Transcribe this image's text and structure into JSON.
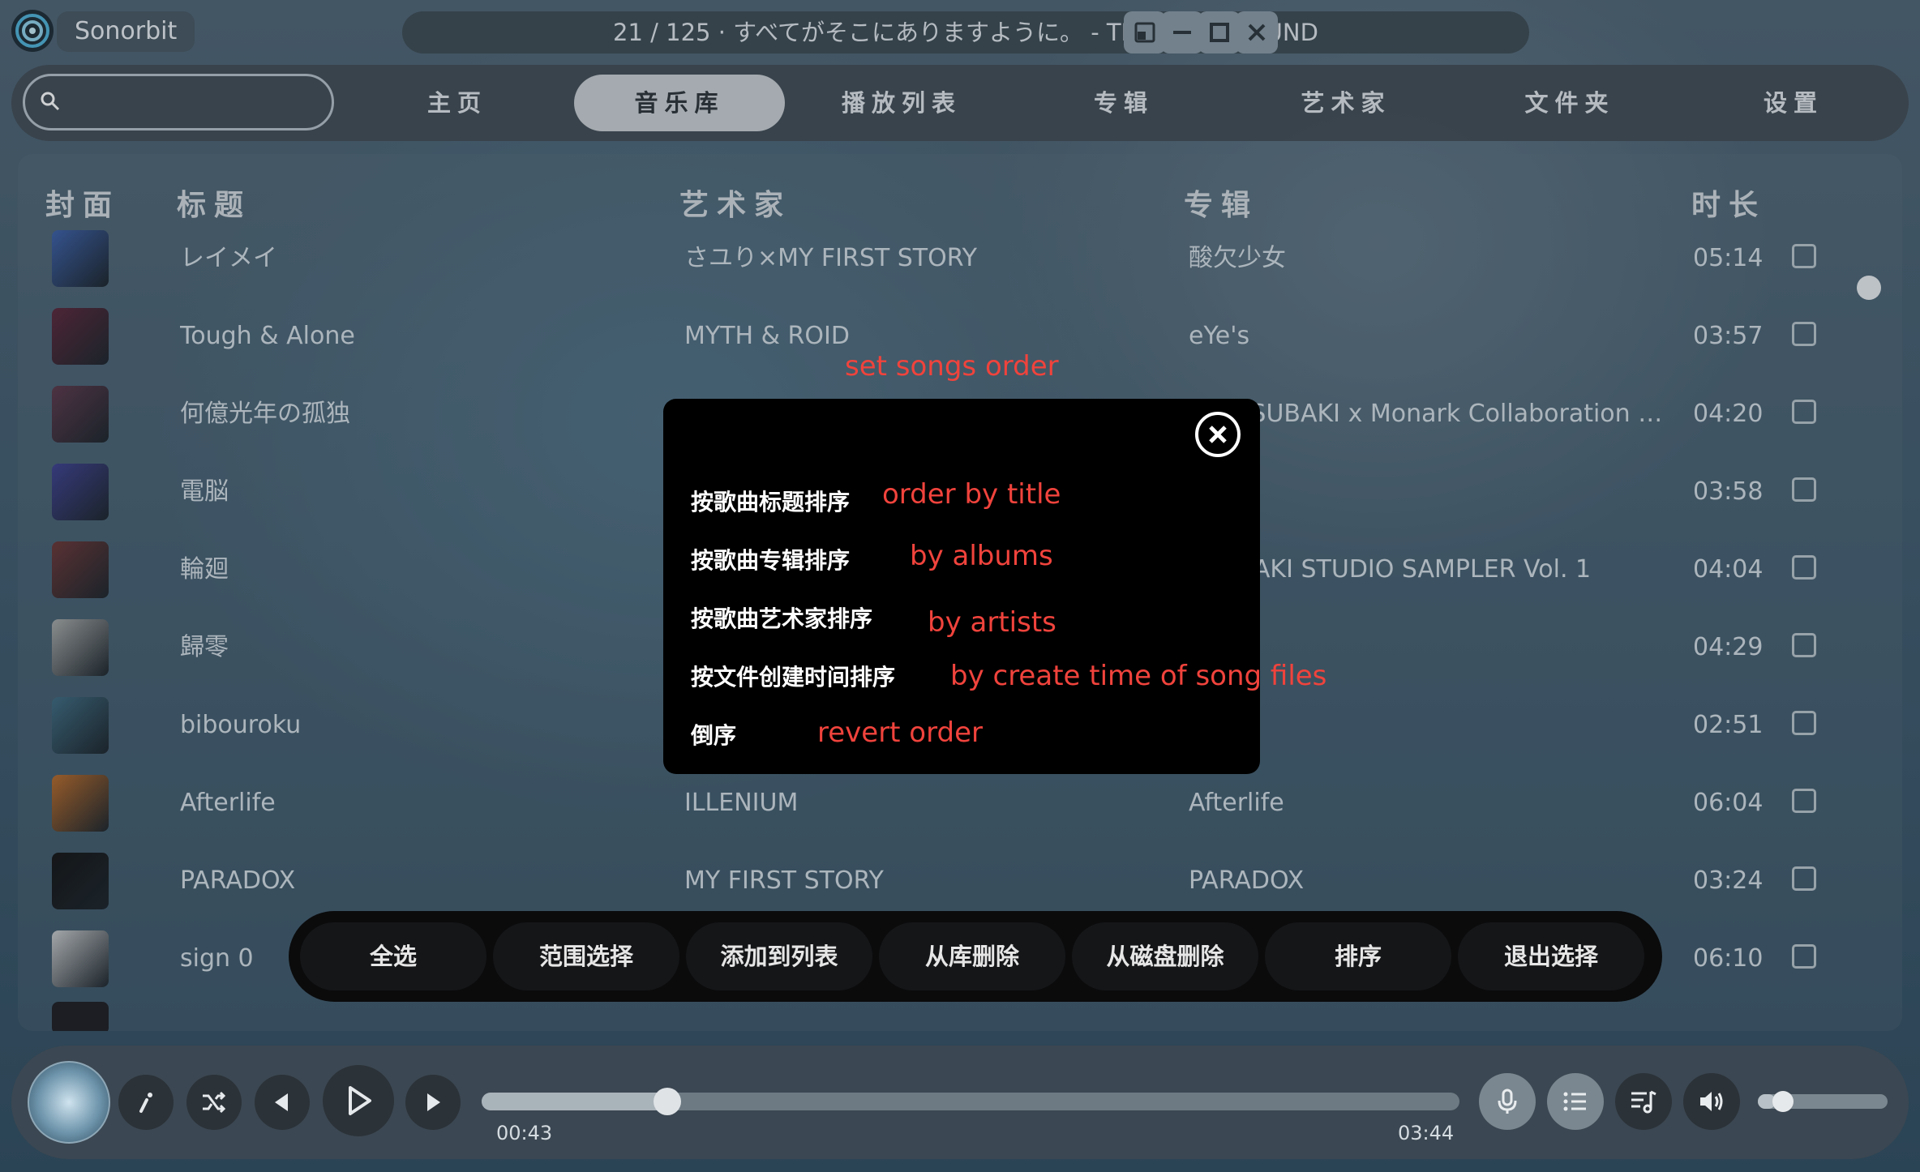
{
  "app": {
    "name": "Sonorbit"
  },
  "now_playing": {
    "text": "21 / 125 · すべてがそこにありますように。 - THE SPELLBOUND"
  },
  "search": {
    "placeholder": "",
    "value": ""
  },
  "nav": {
    "tabs": [
      {
        "label": "主页",
        "active": false
      },
      {
        "label": "音乐库",
        "active": true
      },
      {
        "label": "播放列表",
        "active": false
      },
      {
        "label": "专辑",
        "active": false
      },
      {
        "label": "艺术家",
        "active": false
      },
      {
        "label": "文件夹",
        "active": false
      },
      {
        "label": "设置",
        "active": false
      }
    ]
  },
  "library": {
    "columns": {
      "cover": "封面",
      "title": "标题",
      "artist": "艺术家",
      "album": "专辑",
      "duration": "时长"
    },
    "rows": [
      {
        "title": "レイメイ",
        "artist": "さユり×MY FIRST STORY",
        "album": "酸欠少女",
        "duration": "05:14",
        "cover_color": "#3b5fa8"
      },
      {
        "title": "Tough & Alone",
        "artist": "MYTH & ROID",
        "album": "eYe's",
        "duration": "03:57",
        "cover_color": "#5a2438"
      },
      {
        "title": "何億光年の孤独",
        "artist": "",
        "album": "WA TSUBAKI x Monark Collaboration Albu...",
        "duration": "04:20",
        "cover_color": "#5b3648"
      },
      {
        "title": "電脳",
        "artist": "",
        "album": "",
        "duration": "03:58",
        "cover_color": "#3c3f8e"
      },
      {
        "title": "輪廻",
        "artist": "",
        "album": "TSUBAKI STUDIO SAMPLER Vol. 1",
        "duration": "04:04",
        "cover_color": "#6a3434"
      },
      {
        "title": "歸零",
        "artist": "",
        "album": "",
        "duration": "04:29",
        "cover_color": "#a8aaa8"
      },
      {
        "title": "bibouroku",
        "artist": "",
        "album": "",
        "duration": "02:51",
        "cover_color": "#3d6a80"
      },
      {
        "title": "Afterlife",
        "artist": "ILLENIUM",
        "album": "Afterlife",
        "duration": "06:04",
        "cover_color": "#b86a28"
      },
      {
        "title": "PARADOX",
        "artist": "MY FIRST STORY",
        "album": "PARADOX",
        "duration": "03:24",
        "cover_color": "#111111"
      },
      {
        "title": "sign 0",
        "artist": "",
        "album": "",
        "duration": "06:10",
        "cover_color": "#c9cbcc"
      }
    ]
  },
  "sort_dialog": {
    "options": [
      "按歌曲标题排序",
      "按歌曲专辑排序",
      "按歌曲艺术家排序",
      "按文件创建时间排序",
      "倒序"
    ]
  },
  "annotations": {
    "title": "set songs order",
    "by_title": "order by title",
    "by_albums": "by albums",
    "by_artists": "by artists",
    "by_create_time": "by create time of song files",
    "revert": "revert order"
  },
  "selection_bar": {
    "buttons": [
      "全选",
      "范围选择",
      "添加到列表",
      "从库删除",
      "从磁盘删除",
      "排序",
      "退出选择"
    ]
  },
  "player": {
    "elapsed": "00:43",
    "total": "03:44",
    "progress": 0.19,
    "volume": 0.14
  }
}
